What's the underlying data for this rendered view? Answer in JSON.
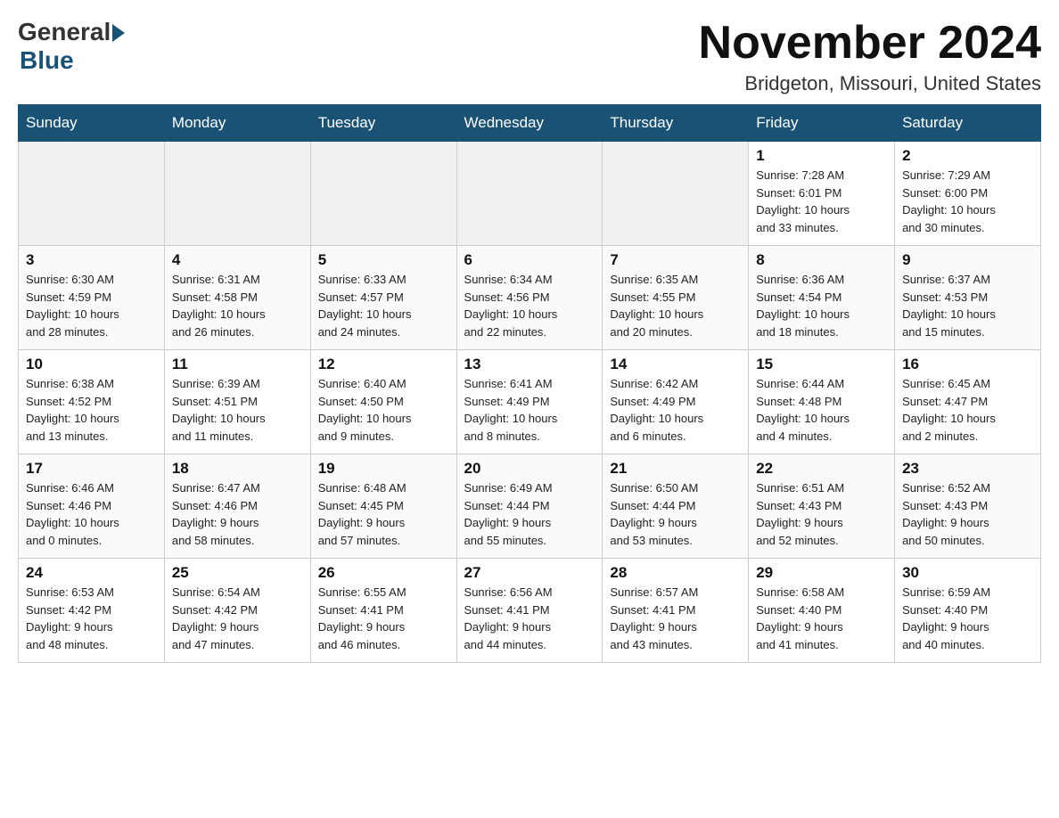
{
  "header": {
    "logo_general": "General",
    "logo_blue": "Blue",
    "month_title": "November 2024",
    "location": "Bridgeton, Missouri, United States"
  },
  "weekdays": [
    "Sunday",
    "Monday",
    "Tuesday",
    "Wednesday",
    "Thursday",
    "Friday",
    "Saturday"
  ],
  "weeks": [
    {
      "days": [
        {
          "num": "",
          "info": ""
        },
        {
          "num": "",
          "info": ""
        },
        {
          "num": "",
          "info": ""
        },
        {
          "num": "",
          "info": ""
        },
        {
          "num": "",
          "info": ""
        },
        {
          "num": "1",
          "info": "Sunrise: 7:28 AM\nSunset: 6:01 PM\nDaylight: 10 hours\nand 33 minutes."
        },
        {
          "num": "2",
          "info": "Sunrise: 7:29 AM\nSunset: 6:00 PM\nDaylight: 10 hours\nand 30 minutes."
        }
      ]
    },
    {
      "days": [
        {
          "num": "3",
          "info": "Sunrise: 6:30 AM\nSunset: 4:59 PM\nDaylight: 10 hours\nand 28 minutes."
        },
        {
          "num": "4",
          "info": "Sunrise: 6:31 AM\nSunset: 4:58 PM\nDaylight: 10 hours\nand 26 minutes."
        },
        {
          "num": "5",
          "info": "Sunrise: 6:33 AM\nSunset: 4:57 PM\nDaylight: 10 hours\nand 24 minutes."
        },
        {
          "num": "6",
          "info": "Sunrise: 6:34 AM\nSunset: 4:56 PM\nDaylight: 10 hours\nand 22 minutes."
        },
        {
          "num": "7",
          "info": "Sunrise: 6:35 AM\nSunset: 4:55 PM\nDaylight: 10 hours\nand 20 minutes."
        },
        {
          "num": "8",
          "info": "Sunrise: 6:36 AM\nSunset: 4:54 PM\nDaylight: 10 hours\nand 18 minutes."
        },
        {
          "num": "9",
          "info": "Sunrise: 6:37 AM\nSunset: 4:53 PM\nDaylight: 10 hours\nand 15 minutes."
        }
      ]
    },
    {
      "days": [
        {
          "num": "10",
          "info": "Sunrise: 6:38 AM\nSunset: 4:52 PM\nDaylight: 10 hours\nand 13 minutes."
        },
        {
          "num": "11",
          "info": "Sunrise: 6:39 AM\nSunset: 4:51 PM\nDaylight: 10 hours\nand 11 minutes."
        },
        {
          "num": "12",
          "info": "Sunrise: 6:40 AM\nSunset: 4:50 PM\nDaylight: 10 hours\nand 9 minutes."
        },
        {
          "num": "13",
          "info": "Sunrise: 6:41 AM\nSunset: 4:49 PM\nDaylight: 10 hours\nand 8 minutes."
        },
        {
          "num": "14",
          "info": "Sunrise: 6:42 AM\nSunset: 4:49 PM\nDaylight: 10 hours\nand 6 minutes."
        },
        {
          "num": "15",
          "info": "Sunrise: 6:44 AM\nSunset: 4:48 PM\nDaylight: 10 hours\nand 4 minutes."
        },
        {
          "num": "16",
          "info": "Sunrise: 6:45 AM\nSunset: 4:47 PM\nDaylight: 10 hours\nand 2 minutes."
        }
      ]
    },
    {
      "days": [
        {
          "num": "17",
          "info": "Sunrise: 6:46 AM\nSunset: 4:46 PM\nDaylight: 10 hours\nand 0 minutes."
        },
        {
          "num": "18",
          "info": "Sunrise: 6:47 AM\nSunset: 4:46 PM\nDaylight: 9 hours\nand 58 minutes."
        },
        {
          "num": "19",
          "info": "Sunrise: 6:48 AM\nSunset: 4:45 PM\nDaylight: 9 hours\nand 57 minutes."
        },
        {
          "num": "20",
          "info": "Sunrise: 6:49 AM\nSunset: 4:44 PM\nDaylight: 9 hours\nand 55 minutes."
        },
        {
          "num": "21",
          "info": "Sunrise: 6:50 AM\nSunset: 4:44 PM\nDaylight: 9 hours\nand 53 minutes."
        },
        {
          "num": "22",
          "info": "Sunrise: 6:51 AM\nSunset: 4:43 PM\nDaylight: 9 hours\nand 52 minutes."
        },
        {
          "num": "23",
          "info": "Sunrise: 6:52 AM\nSunset: 4:43 PM\nDaylight: 9 hours\nand 50 minutes."
        }
      ]
    },
    {
      "days": [
        {
          "num": "24",
          "info": "Sunrise: 6:53 AM\nSunset: 4:42 PM\nDaylight: 9 hours\nand 48 minutes."
        },
        {
          "num": "25",
          "info": "Sunrise: 6:54 AM\nSunset: 4:42 PM\nDaylight: 9 hours\nand 47 minutes."
        },
        {
          "num": "26",
          "info": "Sunrise: 6:55 AM\nSunset: 4:41 PM\nDaylight: 9 hours\nand 46 minutes."
        },
        {
          "num": "27",
          "info": "Sunrise: 6:56 AM\nSunset: 4:41 PM\nDaylight: 9 hours\nand 44 minutes."
        },
        {
          "num": "28",
          "info": "Sunrise: 6:57 AM\nSunset: 4:41 PM\nDaylight: 9 hours\nand 43 minutes."
        },
        {
          "num": "29",
          "info": "Sunrise: 6:58 AM\nSunset: 4:40 PM\nDaylight: 9 hours\nand 41 minutes."
        },
        {
          "num": "30",
          "info": "Sunrise: 6:59 AM\nSunset: 4:40 PM\nDaylight: 9 hours\nand 40 minutes."
        }
      ]
    }
  ]
}
